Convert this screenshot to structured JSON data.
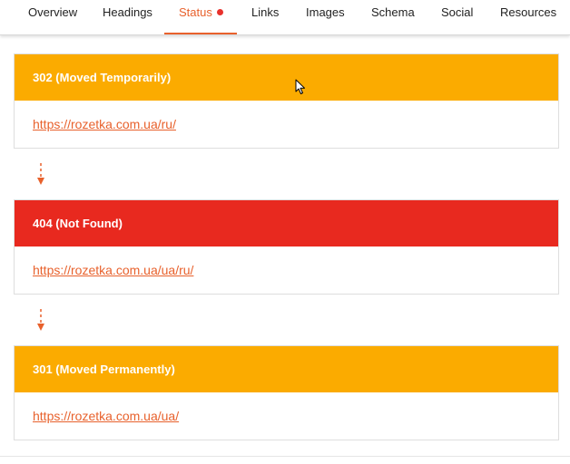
{
  "tabs": [
    {
      "label": "Overview"
    },
    {
      "label": "Headings"
    },
    {
      "label": "Status",
      "active": true,
      "has_indicator": true
    },
    {
      "label": "Links"
    },
    {
      "label": "Images"
    },
    {
      "label": "Schema"
    },
    {
      "label": "Social"
    },
    {
      "label": "Resources"
    }
  ],
  "redirect_chain": [
    {
      "status": "302 (Moved Temporarily)",
      "url": "https://rozetka.com.ua/ru/",
      "color": "#fbab00"
    },
    {
      "status": "404 (Not Found)",
      "url": "https://rozetka.com.ua/ua/ru/",
      "color": "#e8291f"
    },
    {
      "status": "301 (Moved Permanently)",
      "url": "https://rozetka.com.ua/ua/",
      "color": "#fbab00"
    }
  ],
  "colors": {
    "accent": "#e8612c",
    "indicator": "#e8312c",
    "redirect": "#fbab00",
    "error": "#e8291f"
  }
}
